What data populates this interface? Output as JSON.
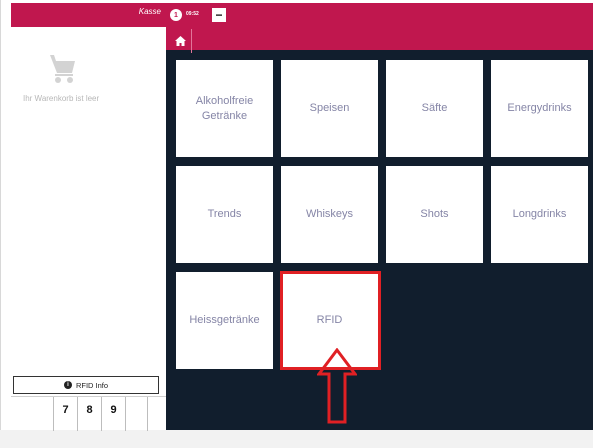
{
  "cart": {
    "header_label": "Kasse",
    "empty_text": "Ihr Warenkorb ist leer",
    "cart_icon": "shopping-cart-icon",
    "rfid_info_label": "RFID Info",
    "rfid_info_icon": "info-icon",
    "keypad_keys": [
      "7",
      "8",
      "9"
    ]
  },
  "topbar": {
    "badge_count": "1",
    "time": "09:52",
    "minus_label": "−",
    "home_icon": "home-icon"
  },
  "categories": [
    {
      "label": "Alkoholfreie Getränke"
    },
    {
      "label": "Speisen"
    },
    {
      "label": "Säfte"
    },
    {
      "label": "Energydrinks"
    },
    {
      "label": "Trends"
    },
    {
      "label": "Whiskeys"
    },
    {
      "label": "Shots"
    },
    {
      "label": "Longdrinks"
    },
    {
      "label": "Heissgetränke"
    },
    {
      "label": "RFID"
    }
  ],
  "colors": {
    "brand": "#c0174e",
    "dark_bg": "#111e2d",
    "tile_text": "#8585a6",
    "highlight": "#e02024"
  }
}
